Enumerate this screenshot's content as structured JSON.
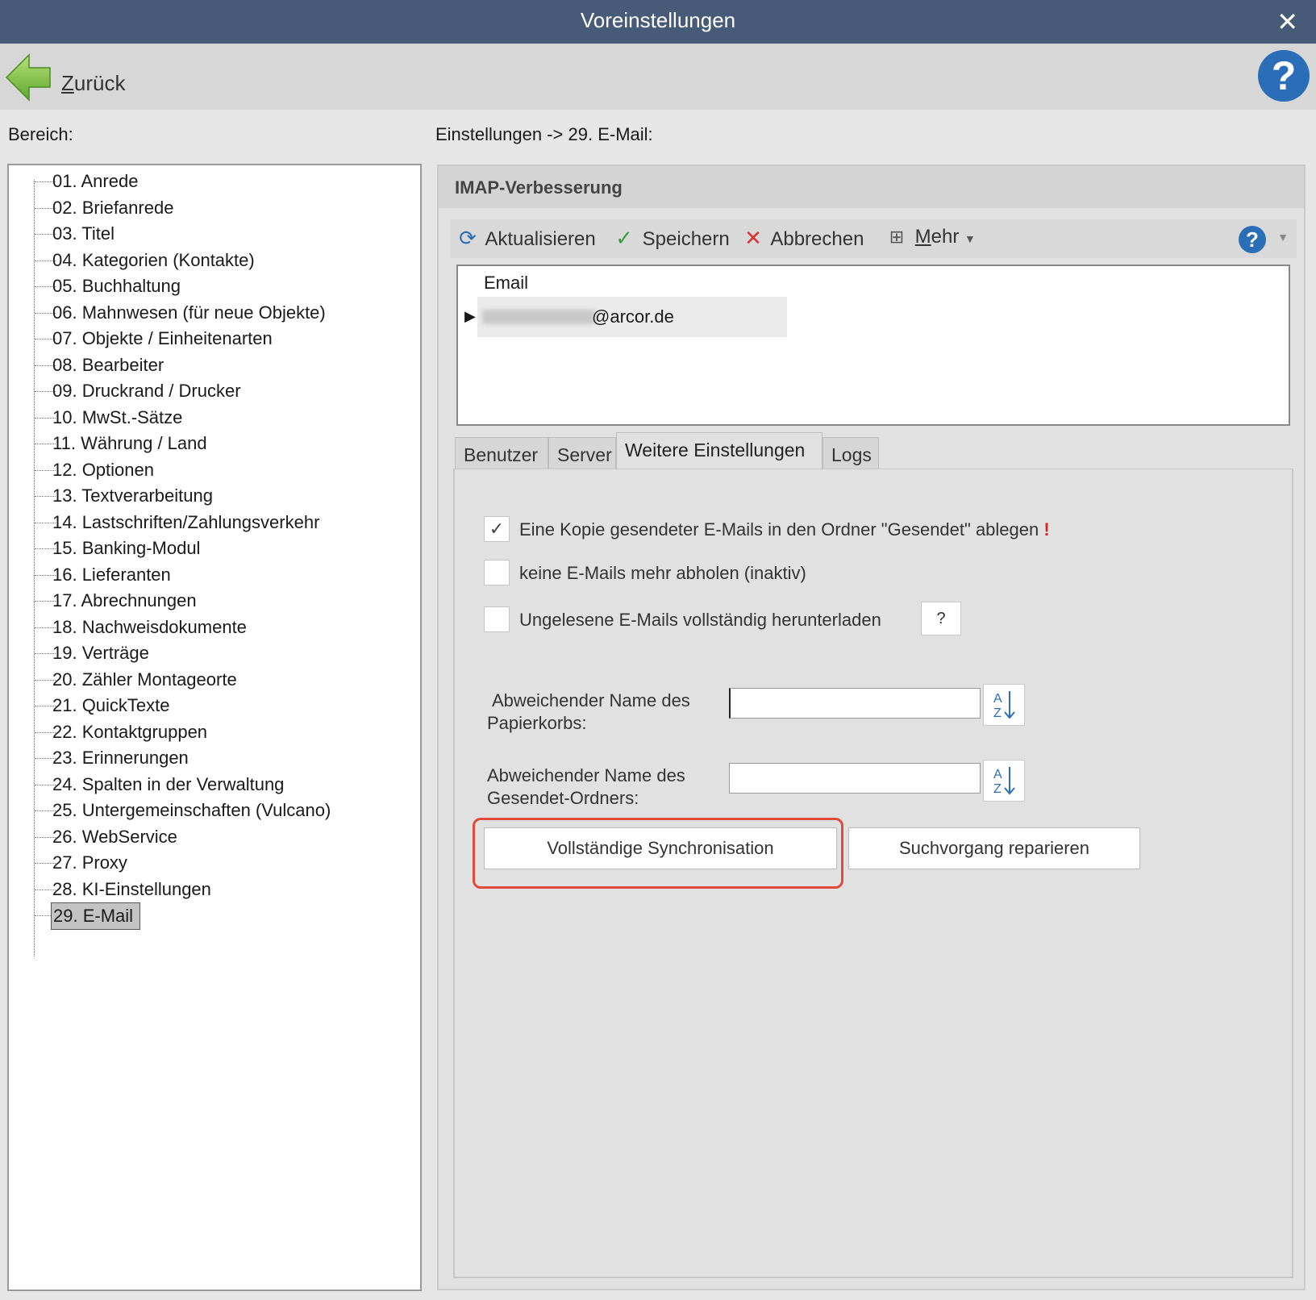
{
  "window": {
    "title": "Voreinstellungen",
    "close_glyph": "✕"
  },
  "topbar": {
    "back_label_first": "Z",
    "back_label_rest": "urück",
    "help_glyph": "?"
  },
  "left": {
    "label": "Bereich:",
    "items": [
      "01. Anrede",
      "02. Briefanrede",
      "03. Titel",
      "04. Kategorien (Kontakte)",
      "05. Buchhaltung",
      "06. Mahnwesen (für neue Objekte)",
      "07. Objekte / Einheitenarten",
      "08. Bearbeiter",
      "09. Druckrand / Drucker",
      "10. MwSt.-Sätze",
      "11. Währung / Land",
      "12. Optionen",
      "13. Textverarbeitung",
      "14. Lastschriften/Zahlungsverkehr",
      "15. Banking-Modul",
      "16. Lieferanten",
      "17. Abrechnungen",
      "18. Nachweisdokumente",
      "19. Verträge",
      "20. Zähler Montageorte",
      "21. QuickTexte",
      "22. Kontaktgruppen",
      "23. Erinnerungen",
      "24. Spalten in der Verwaltung",
      "25. Untergemeinschaften (Vulcano)",
      "26. WebService",
      "27. Proxy",
      "28. KI-Einstellungen",
      "29. E-Mail"
    ],
    "selected_index": 28
  },
  "breadcrumb": "Einstellungen -> 29. E-Mail:",
  "panel": {
    "header": "IMAP-Verbesserung",
    "toolbar": {
      "refresh": "Aktualisieren",
      "save": "Speichern",
      "cancel": "Abbrechen",
      "more_first": "M",
      "more_rest": "ehr",
      "help": "?"
    },
    "grid": {
      "column": "Email",
      "row_email_suffix": "@arcor.de"
    },
    "tabs": [
      "Benutzer",
      "Server",
      "Weitere Einstellungen",
      "Logs"
    ],
    "active_tab": 2,
    "options": {
      "copy_sent": {
        "label": "Eine Kopie gesendeter E-Mails in den Ordner \"Gesendet\" ablegen",
        "checked": true,
        "mark": "!"
      },
      "no_fetch": {
        "label": "keine E-Mails mehr abholen (inaktiv)",
        "checked": false
      },
      "download_unread": {
        "label": "Ungelesene E-Mails vollständig herunterladen",
        "checked": false,
        "help": "?"
      }
    },
    "trash_name": {
      "label_line1": "Abweichender Name des",
      "label_line2": "Papierkorbs:",
      "value": ""
    },
    "sent_name": {
      "label_line1": "Abweichender Name des",
      "label_line2": "Gesendet-Ordners:",
      "value": ""
    },
    "buttons": {
      "full_sync": "Vollständige Synchronisation",
      "repair_search": "Suchvorgang reparieren"
    },
    "highlight_color": "#e04a3a"
  }
}
